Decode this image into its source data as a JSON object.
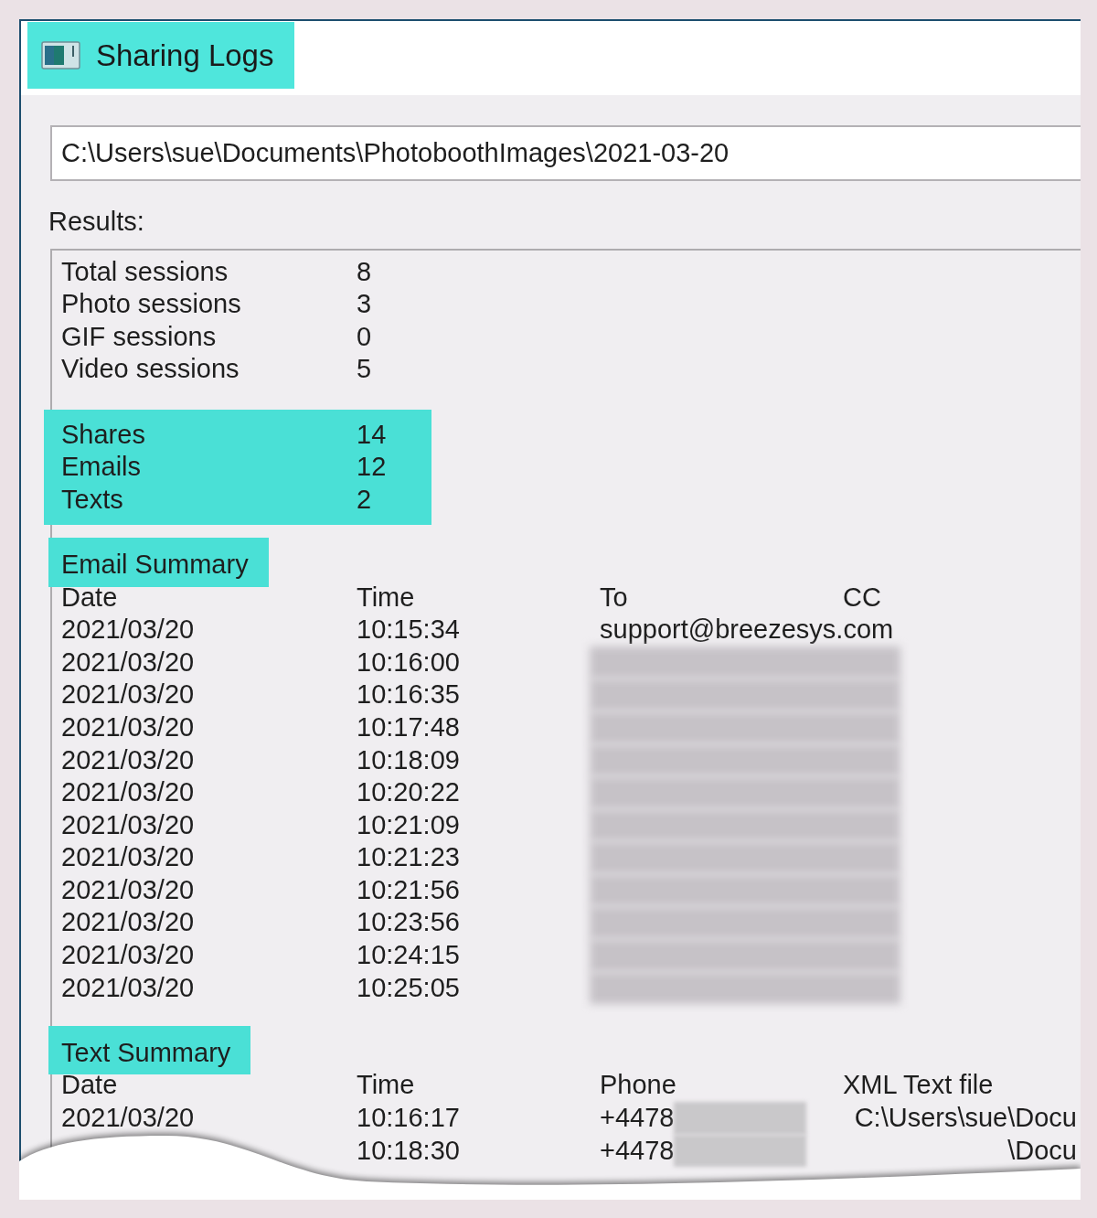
{
  "window": {
    "title": "Sharing Logs",
    "title_highlighted": true
  },
  "path_field": {
    "value": "C:\\Users\\sue\\Documents\\PhotoboothImages\\2021-03-20"
  },
  "results": {
    "label": "Results:",
    "sections": [
      {
        "kind": "stats",
        "highlighted": false,
        "rows": [
          {
            "label": "Total sessions",
            "value": "8"
          },
          {
            "label": "Photo sessions",
            "value": "3"
          },
          {
            "label": "GIF sessions",
            "value": "0"
          },
          {
            "label": "Video sessions",
            "value": "5"
          }
        ]
      },
      {
        "kind": "stats",
        "highlighted": true,
        "rows": [
          {
            "label": "Shares",
            "value": "14"
          },
          {
            "label": "Emails",
            "value": "12"
          },
          {
            "label": "Texts",
            "value": "2"
          }
        ]
      },
      {
        "kind": "table",
        "title": "Email Summary",
        "highlighted": true,
        "columns": [
          "Date",
          "Time",
          "To",
          "CC"
        ],
        "rows": [
          [
            "2021/03/20",
            "10:15:34",
            "support@breezesys.com"
          ],
          [
            "2021/03/20",
            "10:16:00",
            {
              "redacted": true
            }
          ],
          [
            "2021/03/20",
            "10:16:35",
            {
              "redacted": true
            }
          ],
          [
            "2021/03/20",
            "10:17:48",
            {
              "redacted": true
            }
          ],
          [
            "2021/03/20",
            "10:18:09",
            {
              "redacted": true
            }
          ],
          [
            "2021/03/20",
            "10:20:22",
            {
              "redacted": true
            }
          ],
          [
            "2021/03/20",
            "10:21:09",
            {
              "redacted": true
            }
          ],
          [
            "2021/03/20",
            "10:21:23",
            {
              "redacted": true
            }
          ],
          [
            "2021/03/20",
            "10:21:56",
            {
              "redacted": true
            }
          ],
          [
            "2021/03/20",
            "10:23:56",
            {
              "redacted": true
            }
          ],
          [
            "2021/03/20",
            "10:24:15",
            {
              "redacted": true
            }
          ],
          [
            "2021/03/20",
            "10:25:05",
            {
              "redacted": true
            }
          ]
        ]
      },
      {
        "kind": "table",
        "title": "Text Summary",
        "highlighted": true,
        "columns": [
          "Date",
          "Time",
          "Phone",
          "XML Text file"
        ],
        "rows": [
          [
            "2021/03/20",
            "10:16:17",
            {
              "text": "+4478",
              "redacted": true
            },
            "C:\\Users\\sue\\Docu"
          ],
          [
            null,
            "10:18:30",
            {
              "text": "+4478",
              "redacted": true
            },
            "\\Docu"
          ]
        ]
      }
    ]
  }
}
